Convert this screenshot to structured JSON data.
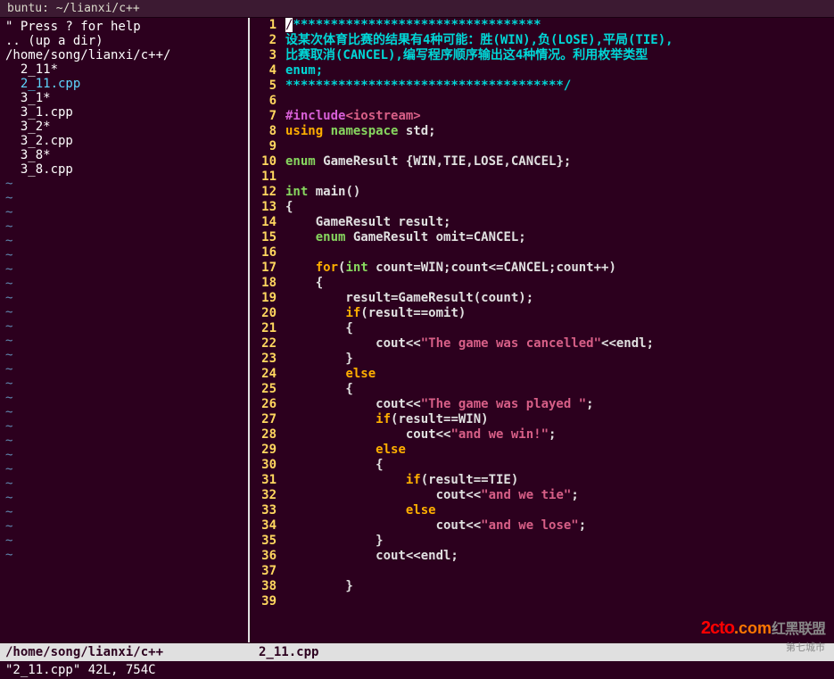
{
  "titlebar": "buntu: ~/lianxi/c++",
  "sidebar": {
    "header": "\" Press ? for help",
    "blank": "",
    "up": ".. (up a dir)",
    "path": "/home/song/lianxi/c++/",
    "items": [
      "2_11*",
      "2_11.cpp",
      "3_1*",
      "3_1.cpp",
      "3_2*",
      "3_2.cpp",
      "3_8*",
      "3_8.cpp"
    ],
    "selected_index": 1
  },
  "code": {
    "lines": [
      {
        "n": 1,
        "seg": [
          {
            "c": "c-cursor",
            "t": "/"
          },
          {
            "c": "c-comment",
            "t": "*********************************"
          }
        ]
      },
      {
        "n": 2,
        "seg": [
          {
            "c": "c-comment",
            "t": "设某次体育比赛的结果有4种可能：胜(WIN),负(LOSE),平局(TIE),"
          }
        ]
      },
      {
        "n": 3,
        "seg": [
          {
            "c": "c-comment",
            "t": "比赛取消(CANCEL),编写程序顺序输出这4种情况。利用枚举类型"
          }
        ]
      },
      {
        "n": 4,
        "seg": [
          {
            "c": "c-comment",
            "t": "enum;"
          }
        ]
      },
      {
        "n": 5,
        "seg": [
          {
            "c": "c-comment",
            "t": "*************************************/"
          }
        ]
      },
      {
        "n": 6,
        "seg": []
      },
      {
        "n": 7,
        "seg": [
          {
            "c": "c-preproc",
            "t": "#include"
          },
          {
            "c": "c-string",
            "t": "<iostream>"
          }
        ]
      },
      {
        "n": 8,
        "seg": [
          {
            "c": "c-keyword",
            "t": "using"
          },
          {
            "c": "c-normal",
            "t": " "
          },
          {
            "c": "c-type",
            "t": "namespace"
          },
          {
            "c": "c-normal",
            "t": " std;"
          }
        ]
      },
      {
        "n": 9,
        "seg": []
      },
      {
        "n": 10,
        "seg": [
          {
            "c": "c-type",
            "t": "enum"
          },
          {
            "c": "c-normal",
            "t": " GameResult {WIN,TIE,LOSE,CANCEL};"
          }
        ]
      },
      {
        "n": 11,
        "seg": []
      },
      {
        "n": 12,
        "seg": [
          {
            "c": "c-type",
            "t": "int"
          },
          {
            "c": "c-normal",
            "t": " main()"
          }
        ]
      },
      {
        "n": 13,
        "seg": [
          {
            "c": "c-normal",
            "t": "{"
          }
        ]
      },
      {
        "n": 14,
        "seg": [
          {
            "c": "c-normal",
            "t": "    GameResult result;"
          }
        ]
      },
      {
        "n": 15,
        "seg": [
          {
            "c": "c-normal",
            "t": "    "
          },
          {
            "c": "c-type",
            "t": "enum"
          },
          {
            "c": "c-normal",
            "t": " GameResult omit=CANCEL;"
          }
        ]
      },
      {
        "n": 16,
        "seg": []
      },
      {
        "n": 17,
        "seg": [
          {
            "c": "c-normal",
            "t": "    "
          },
          {
            "c": "c-keyword",
            "t": "for"
          },
          {
            "c": "c-normal",
            "t": "("
          },
          {
            "c": "c-type",
            "t": "int"
          },
          {
            "c": "c-normal",
            "t": " count=WIN;count<=CANCEL;count++)"
          }
        ]
      },
      {
        "n": 18,
        "seg": [
          {
            "c": "c-normal",
            "t": "    {"
          }
        ]
      },
      {
        "n": 19,
        "seg": [
          {
            "c": "c-normal",
            "t": "        result=GameResult(count);"
          }
        ]
      },
      {
        "n": 20,
        "seg": [
          {
            "c": "c-normal",
            "t": "        "
          },
          {
            "c": "c-keyword",
            "t": "if"
          },
          {
            "c": "c-normal",
            "t": "(result==omit)"
          }
        ]
      },
      {
        "n": 21,
        "seg": [
          {
            "c": "c-normal",
            "t": "        {"
          }
        ]
      },
      {
        "n": 22,
        "seg": [
          {
            "c": "c-normal",
            "t": "            cout<<"
          },
          {
            "c": "c-string",
            "t": "\"The game was cancelled\""
          },
          {
            "c": "c-normal",
            "t": "<<endl;"
          }
        ]
      },
      {
        "n": 23,
        "seg": [
          {
            "c": "c-normal",
            "t": "        }"
          }
        ]
      },
      {
        "n": 24,
        "seg": [
          {
            "c": "c-normal",
            "t": "        "
          },
          {
            "c": "c-keyword",
            "t": "else"
          }
        ]
      },
      {
        "n": 25,
        "seg": [
          {
            "c": "c-normal",
            "t": "        {"
          }
        ]
      },
      {
        "n": 26,
        "seg": [
          {
            "c": "c-normal",
            "t": "            cout<<"
          },
          {
            "c": "c-string",
            "t": "\"The game was played \""
          },
          {
            "c": "c-normal",
            "t": ";"
          }
        ]
      },
      {
        "n": 27,
        "seg": [
          {
            "c": "c-normal",
            "t": "            "
          },
          {
            "c": "c-keyword",
            "t": "if"
          },
          {
            "c": "c-normal",
            "t": "(result==WIN)"
          }
        ]
      },
      {
        "n": 28,
        "seg": [
          {
            "c": "c-normal",
            "t": "                cout<<"
          },
          {
            "c": "c-string",
            "t": "\"and we win!\""
          },
          {
            "c": "c-normal",
            "t": ";"
          }
        ]
      },
      {
        "n": 29,
        "seg": [
          {
            "c": "c-normal",
            "t": "            "
          },
          {
            "c": "c-keyword",
            "t": "else"
          }
        ]
      },
      {
        "n": 30,
        "seg": [
          {
            "c": "c-normal",
            "t": "            {"
          }
        ]
      },
      {
        "n": 31,
        "seg": [
          {
            "c": "c-normal",
            "t": "                "
          },
          {
            "c": "c-keyword",
            "t": "if"
          },
          {
            "c": "c-normal",
            "t": "(result==TIE)"
          }
        ]
      },
      {
        "n": 32,
        "seg": [
          {
            "c": "c-normal",
            "t": "                    cout<<"
          },
          {
            "c": "c-string",
            "t": "\"and we tie\""
          },
          {
            "c": "c-normal",
            "t": ";"
          }
        ]
      },
      {
        "n": 33,
        "seg": [
          {
            "c": "c-normal",
            "t": "                "
          },
          {
            "c": "c-keyword",
            "t": "else"
          }
        ]
      },
      {
        "n": 34,
        "seg": [
          {
            "c": "c-normal",
            "t": "                    cout<<"
          },
          {
            "c": "c-string",
            "t": "\"and we lose\""
          },
          {
            "c": "c-normal",
            "t": ";"
          }
        ]
      },
      {
        "n": 35,
        "seg": [
          {
            "c": "c-normal",
            "t": "            }"
          }
        ]
      },
      {
        "n": 36,
        "seg": [
          {
            "c": "c-normal",
            "t": "            cout<<endl;"
          }
        ]
      },
      {
        "n": 37,
        "seg": []
      },
      {
        "n": 38,
        "seg": [
          {
            "c": "c-normal",
            "t": "        }"
          }
        ]
      },
      {
        "n": 39,
        "seg": []
      }
    ]
  },
  "status": {
    "left": "/home/song/lianxi/c++",
    "right": "2_11.cpp"
  },
  "cmdline": "\"2_11.cpp\" 42L, 754C",
  "watermark": {
    "a": "2cto",
    "b": "红黑联盟",
    "c": "第七城市",
    "d": ".com"
  }
}
